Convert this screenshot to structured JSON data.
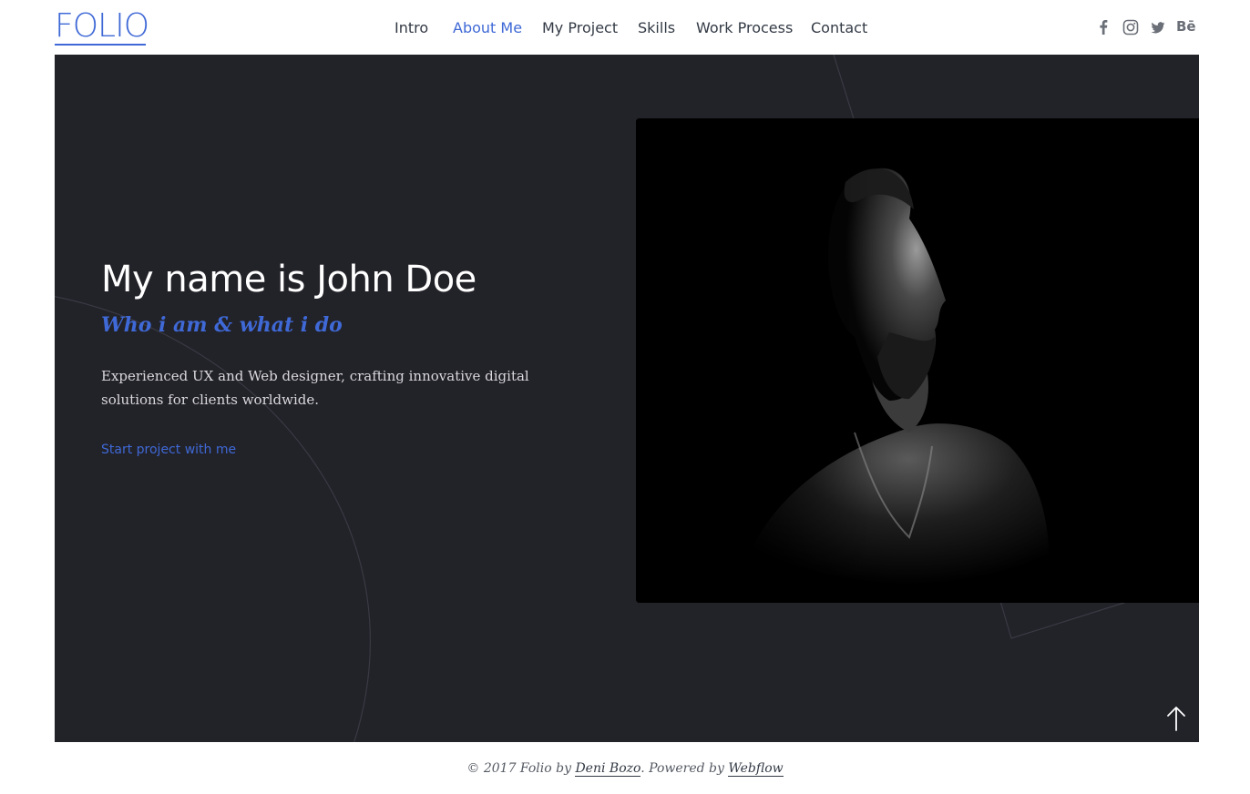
{
  "brand": {
    "logo_text": "FOLIO",
    "color": "#3f69d6"
  },
  "nav": {
    "items": [
      {
        "label": "Intro",
        "active": false
      },
      {
        "label": "About Me",
        "active": true
      },
      {
        "label": "My Project",
        "active": false
      },
      {
        "label": "Skills",
        "active": false
      },
      {
        "label": "Work Process",
        "active": false
      },
      {
        "label": "Contact",
        "active": false
      }
    ]
  },
  "social": {
    "icons": [
      "facebook-icon",
      "instagram-icon",
      "twitter-icon",
      "behance-icon"
    ],
    "behance_text": "Bē"
  },
  "hero": {
    "title": "My name is John Doe",
    "subtitle": "Who i am & what i do",
    "description": "Experienced UX and Web designer, crafting innovative digital solutions for clients worldwide.",
    "cta_label": "Start project with me",
    "background": "#222229",
    "accent": "#3f69d6"
  },
  "footer": {
    "prefix": "© 2017 Folio by ",
    "author": "Deni Bozo",
    "middle": ". Powered by ",
    "platform": "Webflow"
  }
}
